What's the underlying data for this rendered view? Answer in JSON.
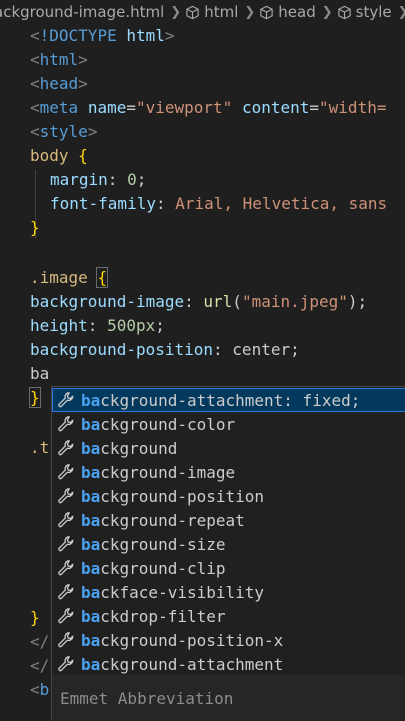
{
  "breadcrumb": {
    "file": "ackground-image.html",
    "items": [
      "html",
      "head",
      "style"
    ]
  },
  "code": {
    "doctype": "!DOCTYPE",
    "html": "html",
    "head": "head",
    "meta": "meta",
    "meta_name_attr": "name",
    "meta_name_val": "\"viewport\"",
    "meta_content_attr": "content",
    "meta_content_val": "\"width=",
    "style": "style",
    "body_sel": "body",
    "margin_prop": "margin",
    "margin_val": "0",
    "font_prop": "font-family",
    "font_val": "Arial, Helvetica, sans",
    "image_sel": ".image",
    "bgimg_prop": "background-image",
    "bgimg_fn": "url",
    "bgimg_str": "\"main.jpeg\"",
    "height_prop": "height",
    "height_val": "500px",
    "bgpos_prop": "background-position",
    "bgpos_val": "center",
    "typed": "ba",
    "line_t": ".t"
  },
  "autocomplete": {
    "match_prefix": "ba",
    "items": [
      {
        "match": "ba",
        "rest": "ckground-attachment: fixed;",
        "icon": "wrench-icon",
        "selected": true
      },
      {
        "match": "ba",
        "rest": "ckground-color",
        "icon": "wrench-icon"
      },
      {
        "match": "ba",
        "rest": "ckground",
        "icon": "wrench-icon"
      },
      {
        "match": "ba",
        "rest": "ckground-image",
        "icon": "wrench-icon"
      },
      {
        "match": "ba",
        "rest": "ckground-position",
        "icon": "wrench-icon"
      },
      {
        "match": "ba",
        "rest": "ckground-repeat",
        "icon": "wrench-icon"
      },
      {
        "match": "ba",
        "rest": "ckground-size",
        "icon": "wrench-icon"
      },
      {
        "match": "ba",
        "rest": "ckground-clip",
        "icon": "wrench-icon"
      },
      {
        "match": "ba",
        "rest": "ckface-visibility",
        "icon": "wrench-icon"
      },
      {
        "match": "ba",
        "rest": "ckdrop-filter",
        "icon": "wrench-icon"
      },
      {
        "match": "ba",
        "rest": "ckground-position-x",
        "icon": "wrench-icon"
      },
      {
        "match": "ba",
        "rest": "ckground-attachment",
        "icon": "wrench-icon"
      }
    ],
    "footer": "Emmet Abbreviation"
  },
  "colors": {
    "background": "#1f1f1f",
    "tag": "#569cd6",
    "attribute": "#9cdcfe",
    "string": "#ce9178",
    "selector": "#d7ba7d",
    "match_highlight": "#4aa1f0",
    "selected_row": "#04395e"
  }
}
